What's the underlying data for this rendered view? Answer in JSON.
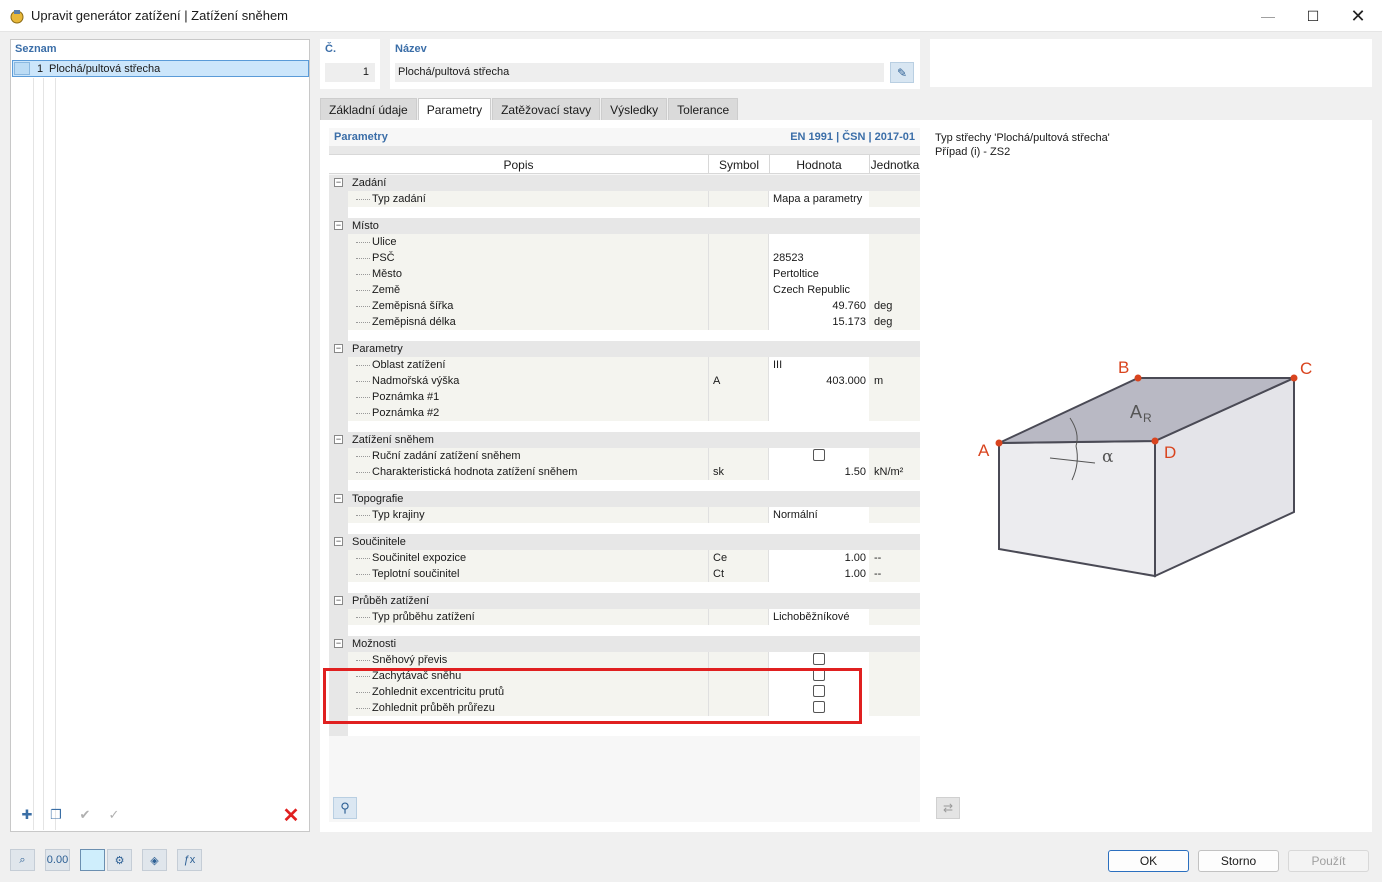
{
  "window": {
    "title": "Upravit generátor zatížení | Zatížení sněhem",
    "minimize_icon": "minimize-icon",
    "maximize_icon": "maximize-icon",
    "close_icon": "close-icon"
  },
  "list": {
    "header": "Seznam",
    "items": [
      {
        "num": "1",
        "label": "Plochá/pultová střecha"
      }
    ]
  },
  "number": {
    "label": "Č.",
    "value": "1"
  },
  "name": {
    "label": "Název",
    "value": "Plochá/pultová střecha"
  },
  "tabs": [
    "Základní údaje",
    "Parametry",
    "Zatěžovací stavy",
    "Výsledky",
    "Tolerance"
  ],
  "active_tab": "Parametry",
  "params": {
    "title": "Parametry",
    "norm": "EN 1991 | ČSN | 2017-01",
    "columns": {
      "popis": "Popis",
      "symbol": "Symbol",
      "hodnota": "Hodnota",
      "jednotka": "Jednotka"
    },
    "groups": {
      "zadani": {
        "label": "Zadání",
        "typ_label": "Typ zadání",
        "typ_value": "Mapa a parametry"
      },
      "misto": {
        "label": "Místo",
        "ulice": "Ulice",
        "psc_label": "PSČ",
        "psc_value": "28523",
        "mesto_label": "Město",
        "mesto_value": "Pertoltice",
        "zeme_label": "Země",
        "zeme_value": "Czech Republic",
        "sirka_label": "Zeměpisná šířka",
        "sirka_value": "49.760",
        "sirka_unit": "deg",
        "delka_label": "Zeměpisná délka",
        "delka_value": "15.173",
        "delka_unit": "deg"
      },
      "parametry": {
        "label": "Parametry",
        "oblast_label": "Oblast zatížení",
        "oblast_value": "III",
        "vyska_label": "Nadmořská výška",
        "vyska_symbol": "A",
        "vyska_value": "403.000",
        "vyska_unit": "m",
        "pozn1": "Poznámka #1",
        "pozn2": "Poznámka #2"
      },
      "snih": {
        "label": "Zatížení sněhem",
        "rucni_label": "Ruční zadání zatížení sněhem",
        "char_label": "Charakteristická hodnota zatížení sněhem",
        "char_symbol": "sk",
        "char_value": "1.50",
        "char_unit": "kN/m²"
      },
      "topografie": {
        "label": "Topografie",
        "krajina_label": "Typ krajiny",
        "krajina_value": "Normální"
      },
      "soucinitele": {
        "label": "Součinitele",
        "expozice_label": "Součinitel expozice",
        "expozice_symbol": "Ce",
        "expozice_value": "1.00",
        "expozice_unit": "--",
        "teplotni_label": "Teplotní součinitel",
        "teplotni_symbol": "Ct",
        "teplotni_value": "1.00",
        "teplotni_unit": "--"
      },
      "prubeh": {
        "label": "Průběh zatížení",
        "typ_label": "Typ průběhu zatížení",
        "typ_value": "Lichoběžníkové"
      },
      "moznosti": {
        "label": "Možnosti",
        "previs": "Sněhový převis",
        "zachytavac": "Zachytávač sněhu",
        "excentricita": "Zohlednit excentricitu prutů",
        "prurez": "Zohlednit průběh průřezu"
      }
    }
  },
  "diagram": {
    "line1": "Typ střechy 'Plochá/pultová střecha'",
    "line2": "Případ (i) - ZS2",
    "labels": {
      "A": "A",
      "B": "B",
      "C": "C",
      "D": "D",
      "AR": "A",
      "AR_sub": "R",
      "alpha": "α"
    },
    "accent": "#d9441e"
  },
  "buttons": {
    "ok": "OK",
    "cancel": "Storno",
    "apply": "Použít"
  },
  "colors": {
    "highlight": "#e02020",
    "header_blue": "#3b6ea8"
  }
}
